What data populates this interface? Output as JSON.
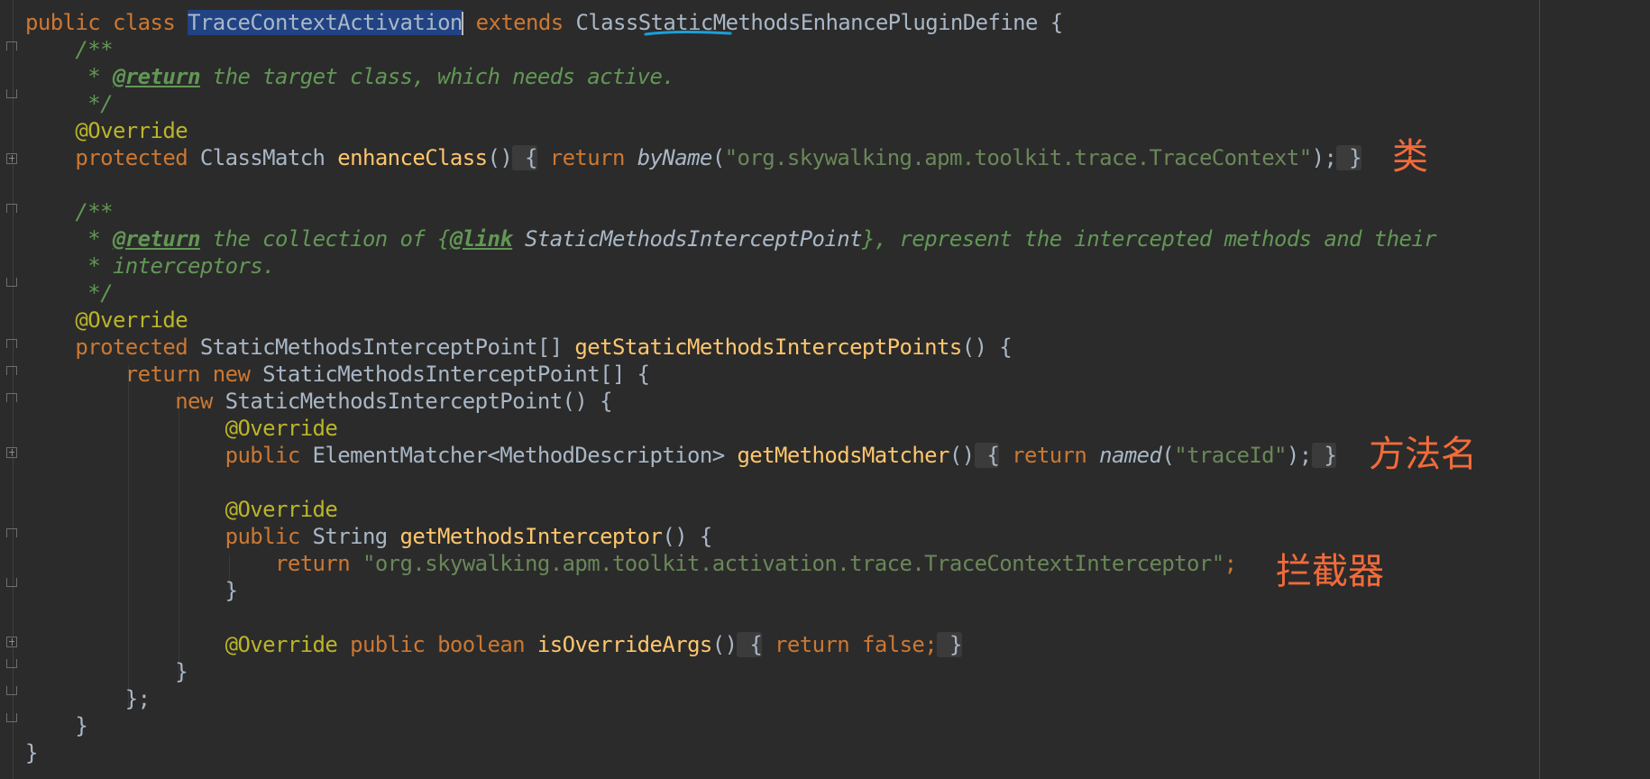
{
  "code": {
    "class_decl": {
      "kw_public": "public",
      "kw_class": "class",
      "class_name": "TraceContextActivation",
      "kw_extends": "extends",
      "super_a": "Class",
      "super_b": "Static",
      "super_c": "MethodsEnhancePluginDefine",
      "brace": " {"
    },
    "doc1_open": "/**",
    "doc1_tag_prefix": " * ",
    "doc1_tag": "@return",
    "doc1_text": " the target class, which needs active.",
    "doc1_close": " */",
    "override": "@Override",
    "enhance": {
      "kw_protected": "protected",
      "type": " ClassMatch ",
      "name": "enhanceClass",
      "parens": "()",
      "fold_open": " {",
      "kw_return": "return",
      "call": "byName",
      "arg_open": "(",
      "arg": "\"org.skywalking.apm.toolkit.trace.TraceContext\"",
      "arg_close": ");",
      "fold_close": " }"
    },
    "doc2_open": "/**",
    "doc2_tag_prefix": " * ",
    "doc2_tag": "@return",
    "doc2_text1": " the collection of {",
    "doc2_link": "@link",
    "doc2_ref": " StaticMethodsInterceptPoint",
    "doc2_text2": "}, represent the intercepted methods and their",
    "doc2_line2": " * interceptors.",
    "doc2_close": " */",
    "points": {
      "kw_protected": "protected",
      "type": " StaticMethodsInterceptPoint[] ",
      "name": "getStaticMethodsInterceptPoints",
      "rest": "() {"
    },
    "ret_new": {
      "kw_return": "return",
      "kw_new": "new",
      "rest": " StaticMethodsInterceptPoint[] {"
    },
    "new_point": {
      "kw_new": "new",
      "rest": " StaticMethodsInterceptPoint() {"
    },
    "matcher": {
      "kw_public": "public",
      "type": " ElementMatcher<MethodDescription> ",
      "name": "getMethodsMatcher",
      "parens": "()",
      "fold_open": " {",
      "kw_return": "return",
      "call": "named",
      "arg_open": "(",
      "arg": "\"traceId\"",
      "arg_close": ");",
      "fold_close": " }"
    },
    "interceptor": {
      "kw_public": "public",
      "type": " String ",
      "name": "getMethodsInterceptor",
      "rest": "() {"
    },
    "ret_str": {
      "kw_return": "return",
      "arg": "\"org.skywalking.apm.toolkit.activation.trace.TraceContextInterceptor\"",
      "semi": ";"
    },
    "close_brace": "}",
    "args": {
      "override": "@Override",
      "kw_public": "public",
      "kw_boolean": "boolean",
      "name": "isOverrideArgs",
      "parens": "()",
      "fold_open": " {",
      "kw_return": "return",
      "kw_false": "false",
      "semi": ";",
      "fold_close": " }"
    },
    "close_array": "};"
  },
  "notes": {
    "class_note": "类",
    "method_note": "方法名",
    "interceptor_note": "拦截器"
  },
  "colors": {
    "background": "#2b2b2b",
    "keyword": "#cc7832",
    "comment": "#629755",
    "annotation": "#bbb529",
    "method": "#ffc66d",
    "string": "#6a8759",
    "note": "#f26b3a",
    "underline": "#1aa0d8"
  }
}
